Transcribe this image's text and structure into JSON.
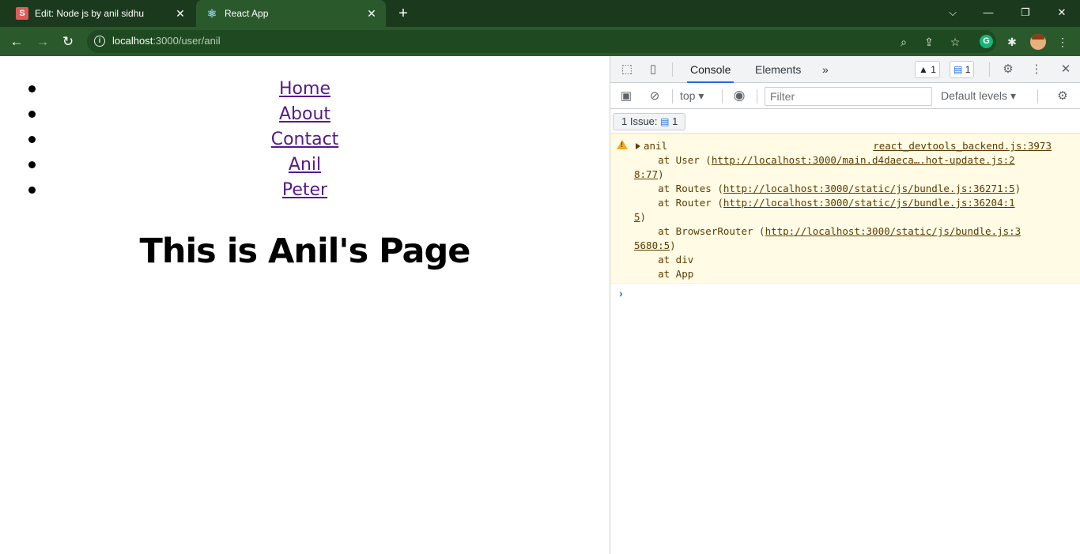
{
  "browser": {
    "tabs": [
      {
        "favicon": "S",
        "title": "Edit: Node js by anil sidhu",
        "active": false
      },
      {
        "favicon": "⚛",
        "title": "React App",
        "active": true
      }
    ],
    "new_tab": "+",
    "window_controls": {
      "dropdown": "⌵",
      "minimize": "—",
      "restore": "❐",
      "close": "✕"
    },
    "url_host": "localhost",
    "url_rest": ":3000/user/anil",
    "icons": [
      "back-arrow-icon",
      "forward-arrow-icon",
      "reload-icon",
      "info-icon",
      "zoom-icon",
      "share-icon",
      "star-icon",
      "grammarly-icon",
      "extensions-icon",
      "profile-avatar",
      "kebab-menu-icon"
    ]
  },
  "page": {
    "nav_links": [
      "Home",
      "About",
      "Contact",
      "Anil",
      "Peter"
    ],
    "heading": "This is Anil's Page",
    "link_color": "#551a8b"
  },
  "devtools": {
    "tabs": {
      "console": "Console",
      "elements": "Elements",
      "more": "»"
    },
    "warnings_count": "1",
    "messages_count": "1",
    "context": "top",
    "filter_placeholder": "Filter",
    "levels": "Default levels",
    "issues_label": "1 Issue:",
    "issues_count": "1",
    "log": {
      "message": "anil",
      "source": "react_devtools_backend.js:3973",
      "stack": [
        {
          "prefix": "    at User (",
          "link": "http://localhost:3000/main.d4daeca….hot-update.js:2",
          "cont": "8:77",
          "suffix": ")"
        },
        {
          "prefix": "    at Routes (",
          "link": "http://localhost:3000/static/js/bundle.js:36271:5",
          "cont": "",
          "suffix": ")"
        },
        {
          "prefix": "    at Router (",
          "link": "http://localhost:3000/static/js/bundle.js:36204:1",
          "cont": "5",
          "suffix": ")"
        },
        {
          "prefix": "    at BrowserRouter (",
          "link": "http://localhost:3000/static/js/bundle.js:3",
          "cont": "5680:5",
          "suffix": ")"
        },
        {
          "prefix": "    at div",
          "link": "",
          "cont": "",
          "suffix": ""
        },
        {
          "prefix": "    at App",
          "link": "",
          "cont": "",
          "suffix": ""
        }
      ]
    },
    "prompt": "›"
  }
}
